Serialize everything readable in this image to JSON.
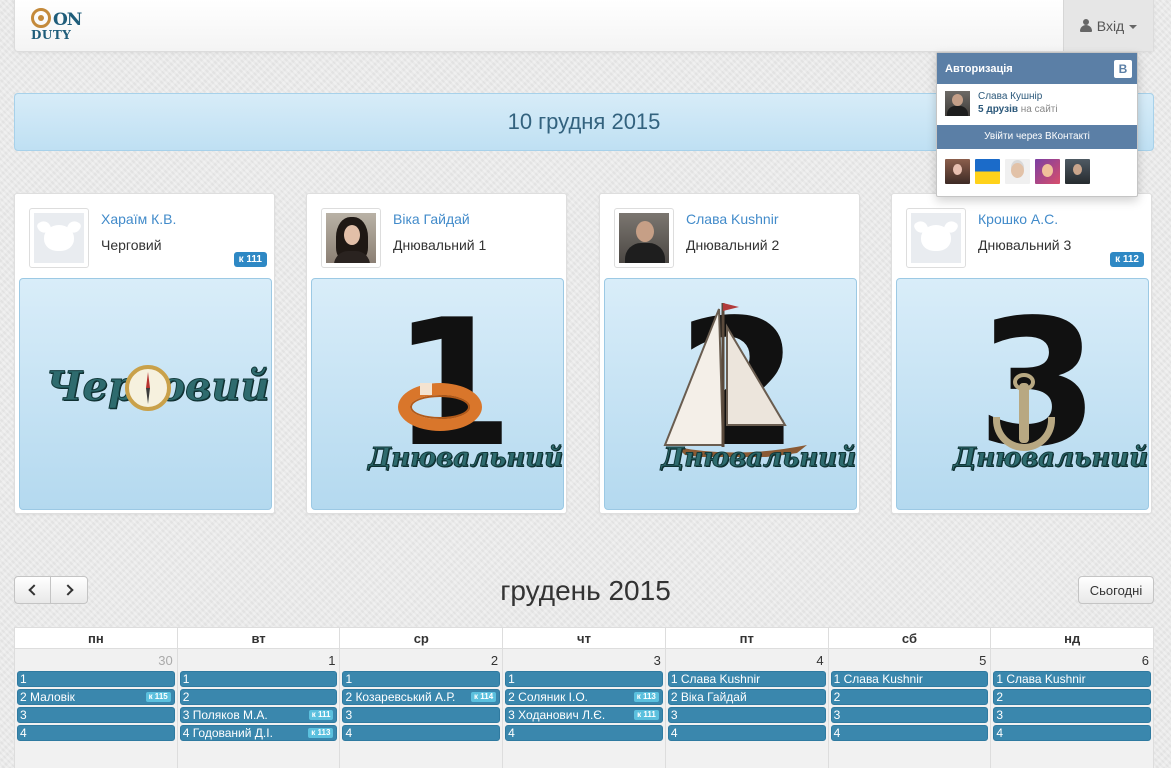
{
  "navbar": {
    "logo_on": "ON",
    "logo_duty": "DUTY",
    "login_label": "Вхід"
  },
  "banner": {
    "date": "10 грудня 2015"
  },
  "cards": [
    {
      "name": "Хараїм К.В.",
      "role": "Черговий",
      "badge": "к 111",
      "image_word": "Черговий"
    },
    {
      "name": "Віка Гайдай",
      "role": "Днювальний 1",
      "badge": "",
      "image_digit": "1",
      "image_word": "Днювальний"
    },
    {
      "name": "Слава Kushnir",
      "role": "Днювальний 2",
      "badge": "",
      "image_digit": "2",
      "image_word": "Днювальний"
    },
    {
      "name": "Крошко А.С.",
      "role": "Днювальний 3",
      "badge": "к 112",
      "image_digit": "3",
      "image_word": "Днювальний"
    }
  ],
  "calendar": {
    "title": "грудень 2015",
    "today_label": "Сьогодні",
    "weekdays": [
      "пн",
      "вт",
      "ср",
      "чт",
      "пт",
      "сб",
      "нд"
    ],
    "days": [
      {
        "num": "30",
        "events": [
          {
            "text": "1",
            "badge": ""
          },
          {
            "text": "2 Маловік",
            "badge": "к 115"
          },
          {
            "text": "3",
            "badge": ""
          },
          {
            "text": "4",
            "badge": ""
          }
        ]
      },
      {
        "num": "1",
        "events": [
          {
            "text": "1",
            "badge": ""
          },
          {
            "text": "2",
            "badge": ""
          },
          {
            "text": "3 Поляков М.А.",
            "badge": "к 111"
          },
          {
            "text": "4 Годований Д.І.",
            "badge": "к 113"
          }
        ]
      },
      {
        "num": "2",
        "events": [
          {
            "text": "1",
            "badge": ""
          },
          {
            "text": "2 Козаревський А.Р.",
            "badge": "к 114"
          },
          {
            "text": "3",
            "badge": ""
          },
          {
            "text": "4",
            "badge": ""
          }
        ]
      },
      {
        "num": "3",
        "events": [
          {
            "text": "1",
            "badge": ""
          },
          {
            "text": "2 Соляник І.О.",
            "badge": "к 113"
          },
          {
            "text": "3 Ходанович Л.Є.",
            "badge": "к 111"
          },
          {
            "text": "4",
            "badge": ""
          }
        ]
      },
      {
        "num": "4",
        "events": [
          {
            "text": "1 Слава Kushnir",
            "badge": ""
          },
          {
            "text": "2 Віка Гайдай",
            "badge": ""
          },
          {
            "text": "3",
            "badge": ""
          },
          {
            "text": "4",
            "badge": ""
          }
        ]
      },
      {
        "num": "5",
        "events": [
          {
            "text": "1 Слава Kushnir",
            "badge": ""
          },
          {
            "text": "2",
            "badge": ""
          },
          {
            "text": "3",
            "badge": ""
          },
          {
            "text": "4",
            "badge": ""
          }
        ]
      },
      {
        "num": "6",
        "events": [
          {
            "text": "1 Слава Kushnir",
            "badge": ""
          },
          {
            "text": "2",
            "badge": ""
          },
          {
            "text": "3",
            "badge": ""
          },
          {
            "text": "4",
            "badge": ""
          }
        ]
      }
    ]
  },
  "vk_dropdown": {
    "title": "Авторизація",
    "logo": "B",
    "user_name": "Слава Кушнір",
    "friends_count": "5 друзів",
    "friends_suffix": " на сайті",
    "login_button": "Увійти через ВКонтакті"
  }
}
